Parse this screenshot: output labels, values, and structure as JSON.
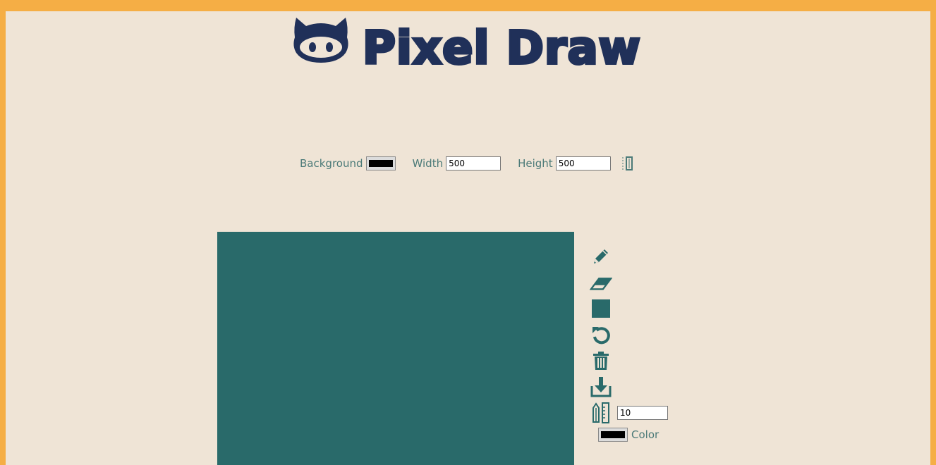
{
  "app": {
    "title": "Pixel Draw",
    "logo_icon": "octocat-pig-icon"
  },
  "settings": {
    "background_label": "Background",
    "background_color": "#000000",
    "width_label": "Width",
    "width_value": "500",
    "height_label": "Height",
    "height_value": "500",
    "resize_icon": "resize-icon"
  },
  "canvas": {
    "fill_color": "#296a6a"
  },
  "tools": {
    "items": [
      "pencil-icon",
      "eraser-icon",
      "fill-icon",
      "undo-icon",
      "trash-icon",
      "download-icon"
    ],
    "brush_size_icon": "pencil-ruler-icon",
    "brush_size_value": "10",
    "color_label": "Color",
    "color_value": "#000000"
  },
  "theme": {
    "accent": "#296a6a",
    "title_color": "#203059",
    "label_color": "#4b7a78",
    "page_bg": "#efe4d6",
    "border_bg": "#f5ae45"
  }
}
